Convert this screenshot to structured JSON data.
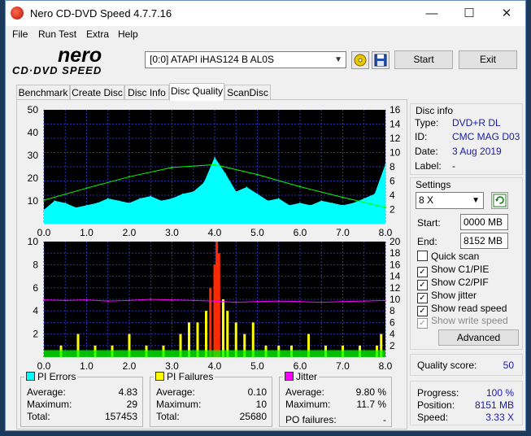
{
  "window": {
    "title": "Nero CD-DVD Speed 4.7.7.16"
  },
  "menu": [
    "File",
    "Run Test",
    "Extra",
    "Help"
  ],
  "logo": {
    "line1": "nero",
    "line2": "CD·DVD SPEED"
  },
  "toolbar": {
    "drive": "[0:0]   ATAPI iHAS124   B AL0S",
    "start_label": "Start",
    "exit_label": "Exit"
  },
  "tabs": [
    "Benchmark",
    "Create Disc",
    "Disc Info",
    "Disc Quality",
    "ScanDisc"
  ],
  "active_tab": "Disc Quality",
  "colors": {
    "plot_bg": "#000000",
    "grid": "#2d2db4",
    "pi_errors": "#00ffff",
    "pi_failures": "#ffff00",
    "jitter": "#ff00ff",
    "read_speed": "#00ff00"
  },
  "chart_data": [
    {
      "type": "area",
      "x_ticks": [
        "0.0",
        "1.0",
        "2.0",
        "3.0",
        "4.0",
        "5.0",
        "6.0",
        "7.0",
        "8.0"
      ],
      "y_ticks_left": [
        "10",
        "20",
        "30",
        "40",
        "50"
      ],
      "y_ticks_right": [
        "2",
        "4",
        "6",
        "8",
        "10",
        "12",
        "14",
        "16"
      ],
      "xlim": [
        0,
        8.0
      ],
      "ylim_left": [
        0,
        50
      ],
      "ylim_right": [
        0,
        16
      ],
      "series": [
        {
          "name": "PI Errors",
          "x": [
            0.0,
            0.25,
            0.5,
            0.75,
            1.0,
            1.25,
            1.5,
            1.75,
            2.0,
            2.25,
            2.5,
            2.75,
            3.0,
            3.25,
            3.5,
            3.75,
            4.0,
            4.25,
            4.5,
            4.75,
            5.0,
            5.25,
            5.5,
            5.75,
            6.0,
            6.25,
            6.5,
            6.75,
            7.0,
            7.25,
            7.5,
            7.75,
            8.0
          ],
          "y": [
            6,
            10,
            9,
            7,
            8,
            9,
            11,
            10,
            9,
            11,
            12,
            10,
            11,
            13,
            14,
            18,
            29,
            22,
            14,
            16,
            13,
            10,
            11,
            8,
            9,
            8,
            10,
            9,
            8,
            9,
            11,
            13,
            26
          ]
        },
        {
          "name": "Read Speed",
          "x": [
            0.0,
            1.0,
            2.0,
            3.0,
            4.0,
            5.0,
            6.0,
            7.0,
            8.0
          ],
          "y": [
            3.3,
            5.0,
            6.6,
            7.9,
            8.3,
            6.9,
            5.2,
            3.7,
            2.3
          ]
        }
      ]
    },
    {
      "type": "bar",
      "x_ticks": [
        "0.0",
        "1.0",
        "2.0",
        "3.0",
        "4.0",
        "5.0",
        "6.0",
        "7.0",
        "8.0"
      ],
      "y_ticks_left": [
        "2",
        "4",
        "6",
        "8",
        "10"
      ],
      "y_ticks_right": [
        "2",
        "4",
        "6",
        "8",
        "10",
        "12",
        "14",
        "16",
        "18",
        "20"
      ],
      "xlim": [
        0,
        8.0
      ],
      "ylim_left": [
        0,
        10
      ],
      "ylim_right": [
        0,
        20
      ],
      "series": [
        {
          "name": "PI Failures",
          "x": [
            0.4,
            0.8,
            1.2,
            1.6,
            2.0,
            2.4,
            2.8,
            3.2,
            3.4,
            3.6,
            3.8,
            3.9,
            4.0,
            4.05,
            4.1,
            4.2,
            4.3,
            4.5,
            4.7,
            4.9,
            5.2,
            5.5,
            5.8,
            6.2,
            6.6,
            7.0,
            7.4,
            7.8,
            7.9
          ],
          "y": [
            1,
            2,
            1,
            1,
            2,
            1,
            1,
            2,
            3,
            3,
            4,
            6,
            8,
            10,
            9,
            5,
            4,
            3,
            2,
            3,
            1,
            1,
            1,
            2,
            1,
            1,
            1,
            1,
            2
          ]
        },
        {
          "name": "Jitter",
          "x": [
            0.0,
            0.5,
            1.0,
            1.5,
            2.0,
            2.5,
            3.0,
            3.5,
            4.0,
            4.5,
            5.0,
            5.5,
            6.0,
            6.5,
            7.0,
            7.5,
            8.0
          ],
          "y": [
            9.9,
            9.8,
            9.9,
            9.7,
            9.8,
            10.0,
            9.9,
            9.8,
            9.7,
            9.5,
            9.6,
            9.7,
            9.6,
            9.5,
            9.6,
            9.7,
            9.8
          ]
        }
      ]
    }
  ],
  "stats": {
    "pi_errors": {
      "title": "PI Errors",
      "average_label": "Average:",
      "average": "4.83",
      "maximum_label": "Maximum:",
      "maximum": "29",
      "total_label": "Total:",
      "total": "157453"
    },
    "pi_failures": {
      "title": "PI Failures",
      "average_label": "Average:",
      "average": "0.10",
      "maximum_label": "Maximum:",
      "maximum": "10",
      "total_label": "Total:",
      "total": "25680"
    },
    "jitter": {
      "title": "Jitter",
      "average_label": "Average:",
      "average": "9.80 %",
      "maximum_label": "Maximum:",
      "maximum": "11.7 %",
      "po_label": "PO failures:",
      "po": "-"
    }
  },
  "disc_info": {
    "title": "Disc info",
    "type_label": "Type:",
    "type": "DVD+R DL",
    "id_label": "ID:",
    "id": "CMC MAG D03",
    "date_label": "Date:",
    "date": "3 Aug 2019",
    "label_label": "Label:",
    "label": "-"
  },
  "settings": {
    "title": "Settings",
    "speed": "8 X",
    "start_label": "Start:",
    "start": "0000 MB",
    "end_label": "End:",
    "end": "8152 MB",
    "quick_scan": "Quick scan",
    "show_c1": "Show C1/PIE",
    "show_c2": "Show C2/PIF",
    "show_jitter": "Show jitter",
    "show_read": "Show read speed",
    "show_write": "Show write speed",
    "advanced": "Advanced"
  },
  "quality": {
    "label": "Quality score:",
    "value": "50"
  },
  "progress": {
    "progress_label": "Progress:",
    "progress": "100 %",
    "position_label": "Position:",
    "position": "8151 MB",
    "speed_label": "Speed:",
    "speed": "3.33 X"
  }
}
